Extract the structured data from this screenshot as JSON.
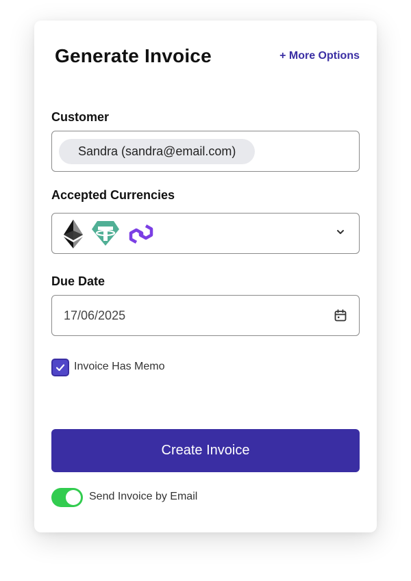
{
  "header": {
    "title": "Generate Invoice",
    "more_options": "+ More Options"
  },
  "customer": {
    "label": "Customer",
    "chip": "Sandra (sandra@email.com)"
  },
  "currencies": {
    "label": "Accepted Currencies",
    "selected": [
      {
        "name": "ETH",
        "icon": "ethereum-icon"
      },
      {
        "name": "USDT",
        "icon": "tether-icon"
      },
      {
        "name": "MATIC",
        "icon": "polygon-icon"
      }
    ]
  },
  "due_date": {
    "label": "Due Date",
    "value": "17/06/2025"
  },
  "memo": {
    "label": "Invoice Has Memo",
    "checked": true
  },
  "actions": {
    "create_label": "Create Invoice"
  },
  "email_toggle": {
    "label": "Send Invoice by Email",
    "on": true
  },
  "colors": {
    "accent": "#3a2ea3",
    "checkbox": "#5046c8",
    "toggle_on": "#32cc4f",
    "tether": "#50af95",
    "polygon": "#7b3fe4",
    "chip_bg": "#e8e9ed"
  }
}
